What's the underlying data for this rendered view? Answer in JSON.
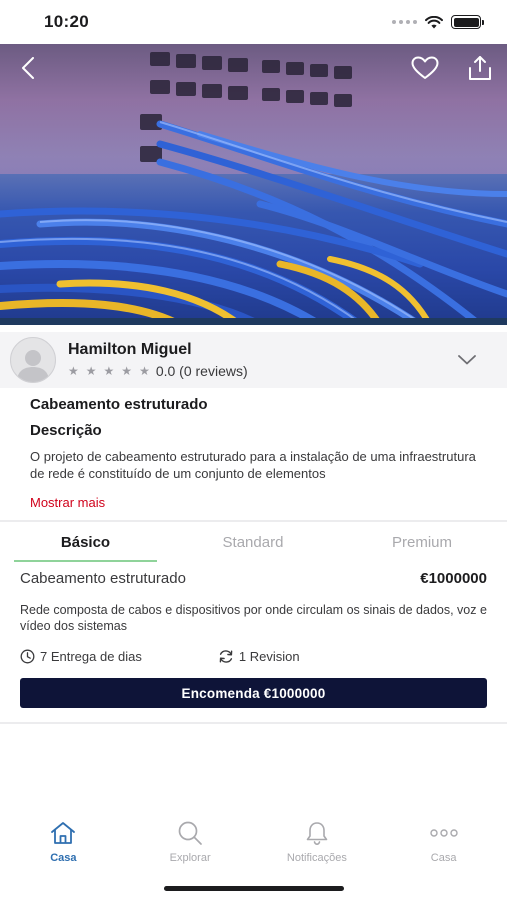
{
  "status_bar": {
    "time": "10:20"
  },
  "seller": {
    "name": "Hamilton Miguel",
    "rating_text": "0.0 (0 reviews)",
    "stars": 5
  },
  "description": {
    "title": "Cabeamento estruturado",
    "subtitle": "Descrição",
    "text": "O projeto de cabeamento estruturado para a instalação de uma infraestrutura de rede é constituído de um conjunto de elementos",
    "show_more": "Mostrar mais"
  },
  "tabs": [
    {
      "label": "Básico",
      "active": true
    },
    {
      "label": "Standard",
      "active": false
    },
    {
      "label": "Premium",
      "active": false
    }
  ],
  "package": {
    "name": "Cabeamento estruturado",
    "price": "€1000000",
    "description": "Rede composta de cabos e dispositivos por onde circulam os sinais de dados, voz e vídeo dos sistemas",
    "delivery": "7 Entrega de dias",
    "revision": "1 Revision",
    "order_label": "Encomenda €1000000"
  },
  "bottom_nav": [
    {
      "label": "Casa",
      "icon": "home-icon",
      "active": true
    },
    {
      "label": "Explorar",
      "icon": "search-icon",
      "active": false
    },
    {
      "label": "Notificações",
      "icon": "bell-icon",
      "active": false
    },
    {
      "label": "Casa",
      "icon": "more-icon",
      "active": false
    }
  ],
  "colors": {
    "accent": "#2f6fb0",
    "order_button": "#0e1438",
    "show_more": "#d0021b",
    "tab_underline": "#8fd39a"
  }
}
